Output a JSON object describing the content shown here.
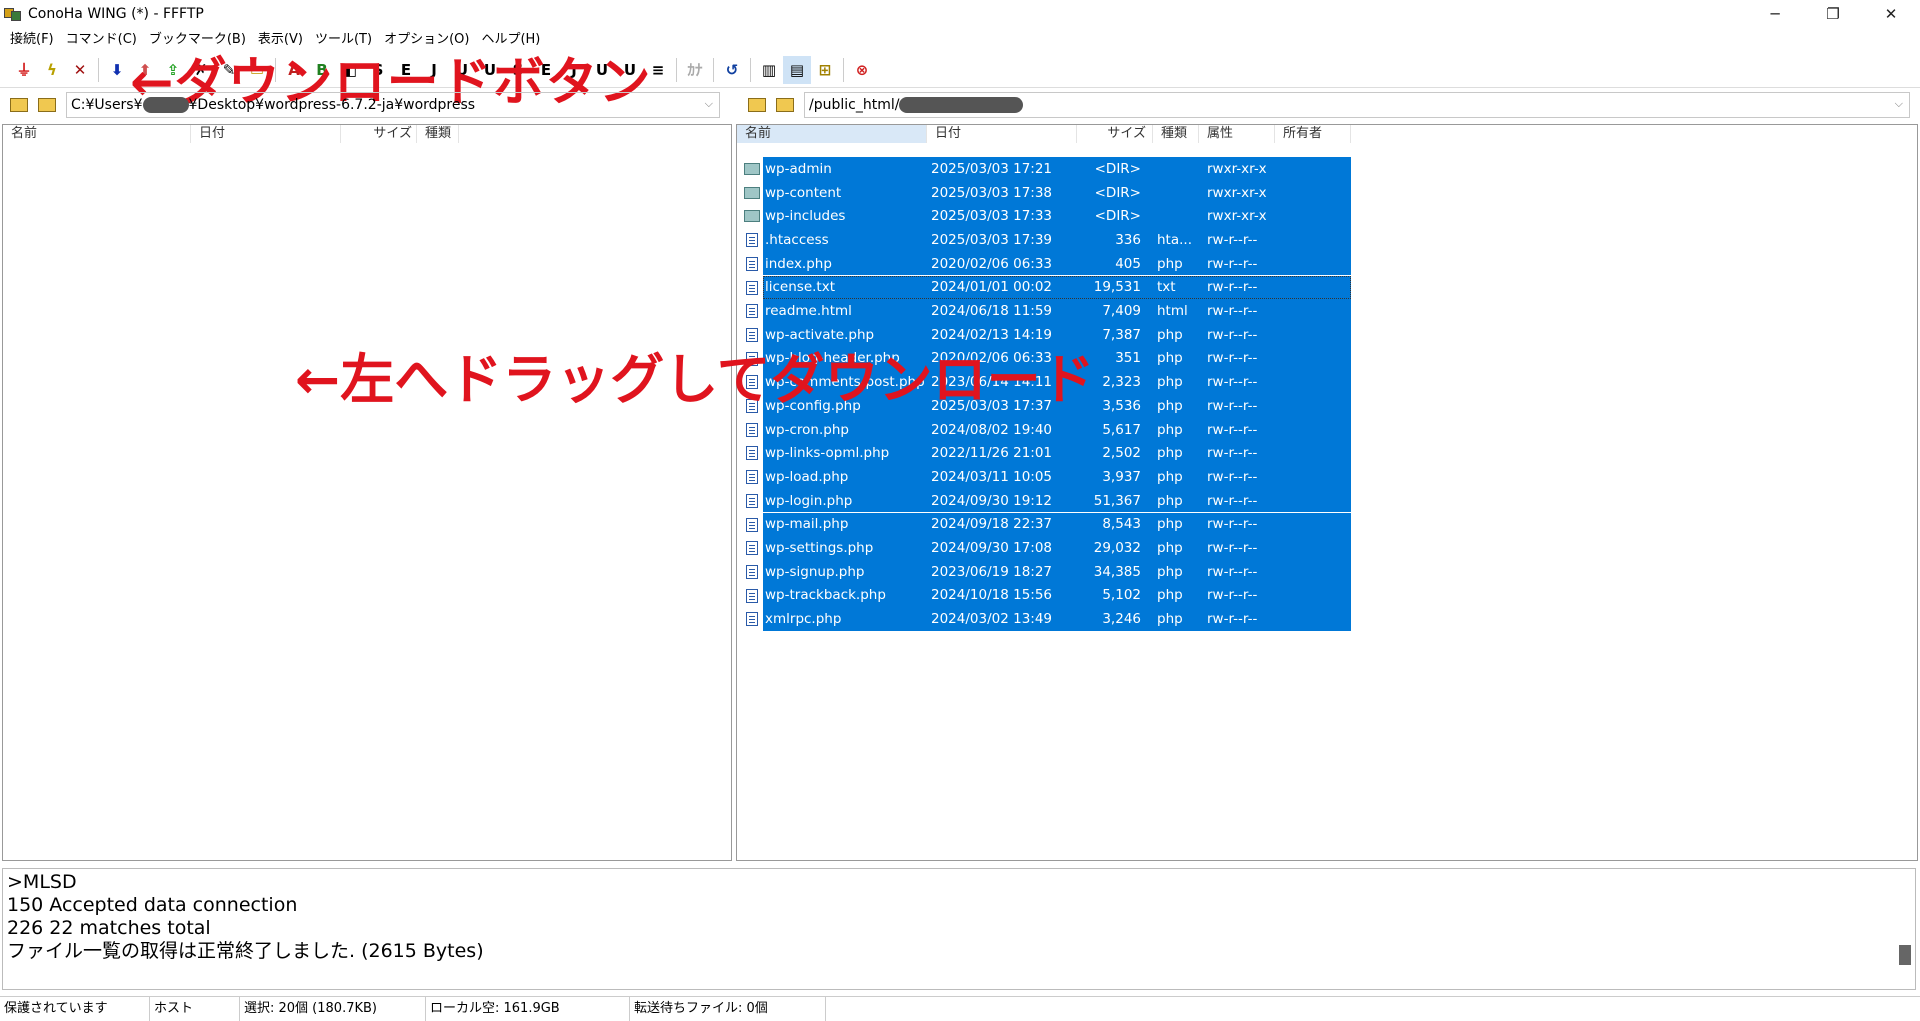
{
  "window": {
    "title": "ConoHa WING (*) - FFFTP"
  },
  "menu": [
    "接続(F)",
    "コマンド(C)",
    "ブックマーク(B)",
    "表示(V)",
    "ツール(T)",
    "オプション(O)",
    "ヘルプ(H)"
  ],
  "toolbar": {
    "buttons": [
      "connect-icon",
      "quick-connect-icon",
      "disconnect-icon",
      "download-icon",
      "upload-icon",
      "mirror-upload-icon",
      "delete-icon",
      "rename-icon",
      "mkdir-icon",
      "ascii-mode-icon",
      "binary-mode-icon",
      "auto-mode-icon",
      "sjis-icon",
      "euc-icon",
      "jis-icon",
      "utf8-icon",
      "utf8-bom-icon",
      "kana-convert-icon",
      "refresh-icon",
      "list-view-icon",
      "detail-view-icon",
      "sync-icon",
      "stop-icon"
    ],
    "kana_label": "ｶﾅ"
  },
  "annotations": {
    "download": "←ダウンロードボタン",
    "drag": "←左へドラッグしてダウンロード",
    "color": "#e0141e"
  },
  "local": {
    "path_prefix": "C:¥Users¥",
    "path_suffix": "¥Desktop¥wordpress-6.7.2-ja¥wordpress",
    "columns": [
      "名前",
      "日付",
      "サイズ",
      "種類"
    ]
  },
  "remote": {
    "path_prefix": "/public_html/",
    "columns": [
      "名前",
      "日付",
      "サイズ",
      "種類",
      "属性",
      "所有者"
    ],
    "files": [
      {
        "name": "wp-admin",
        "date": "2025/03/03 17:21",
        "size": "<DIR>",
        "type": "",
        "attr": "rwxr-xr-x",
        "dir": true
      },
      {
        "name": "wp-content",
        "date": "2025/03/03 17:38",
        "size": "<DIR>",
        "type": "",
        "attr": "rwxr-xr-x",
        "dir": true
      },
      {
        "name": "wp-includes",
        "date": "2025/03/03 17:33",
        "size": "<DIR>",
        "type": "",
        "attr": "rwxr-xr-x",
        "dir": true
      },
      {
        "name": ".htaccess",
        "date": "2025/03/03 17:39",
        "size": "336",
        "type": "hta...",
        "attr": "rw-r--r--",
        "dir": false
      },
      {
        "name": "index.php",
        "date": "2020/02/06 06:33",
        "size": "405",
        "type": "php",
        "attr": "rw-r--r--",
        "dir": false
      },
      {
        "name": "license.txt",
        "date": "2024/01/01 00:02",
        "size": "19,531",
        "type": "txt",
        "attr": "rw-r--r--",
        "dir": false
      },
      {
        "name": "readme.html",
        "date": "2024/06/18 11:59",
        "size": "7,409",
        "type": "html",
        "attr": "rw-r--r--",
        "dir": false
      },
      {
        "name": "wp-activate.php",
        "date": "2024/02/13 14:19",
        "size": "7,387",
        "type": "php",
        "attr": "rw-r--r--",
        "dir": false
      },
      {
        "name": "wp-blog-header.php",
        "date": "2020/02/06 06:33",
        "size": "351",
        "type": "php",
        "attr": "rw-r--r--",
        "dir": false
      },
      {
        "name": "wp-comments-post.php",
        "date": "2023/06/14 14:11",
        "size": "2,323",
        "type": "php",
        "attr": "rw-r--r--",
        "dir": false
      },
      {
        "name": "wp-config.php",
        "date": "2025/03/03 17:37",
        "size": "3,536",
        "type": "php",
        "attr": "rw-r--r--",
        "dir": false
      },
      {
        "name": "wp-cron.php",
        "date": "2024/08/02 19:40",
        "size": "5,617",
        "type": "php",
        "attr": "rw-r--r--",
        "dir": false
      },
      {
        "name": "wp-links-opml.php",
        "date": "2022/11/26 21:01",
        "size": "2,502",
        "type": "php",
        "attr": "rw-r--r--",
        "dir": false
      },
      {
        "name": "wp-load.php",
        "date": "2024/03/11 10:05",
        "size": "3,937",
        "type": "php",
        "attr": "rw-r--r--",
        "dir": false
      },
      {
        "name": "wp-login.php",
        "date": "2024/09/30 19:12",
        "size": "51,367",
        "type": "php",
        "attr": "rw-r--r--",
        "dir": false
      },
      {
        "name": "wp-mail.php",
        "date": "2024/09/18 22:37",
        "size": "8,543",
        "type": "php",
        "attr": "rw-r--r--",
        "dir": false
      },
      {
        "name": "wp-settings.php",
        "date": "2024/09/30 17:08",
        "size": "29,032",
        "type": "php",
        "attr": "rw-r--r--",
        "dir": false
      },
      {
        "name": "wp-signup.php",
        "date": "2023/06/19 18:27",
        "size": "34,385",
        "type": "php",
        "attr": "rw-r--r--",
        "dir": false
      },
      {
        "name": "wp-trackback.php",
        "date": "2024/10/18 15:56",
        "size": "5,102",
        "type": "php",
        "attr": "rw-r--r--",
        "dir": false
      },
      {
        "name": "xmlrpc.php",
        "date": "2024/03/02 13:49",
        "size": "3,246",
        "type": "php",
        "attr": "rw-r--r--",
        "dir": false
      }
    ]
  },
  "log": [
    ">MLSD",
    "150 Accepted data connection",
    "226 22 matches total",
    "ファイル一覧の取得は正常終了しました. (2615 Bytes)"
  ],
  "status": [
    "保護されています",
    "ホスト",
    "選択: 20個 (180.7KB)",
    "ローカル空: 161.9GB",
    "転送待ちファイル: 0個"
  ],
  "colors": {
    "selection": "#0078d7",
    "annotation": "#e0141e"
  }
}
